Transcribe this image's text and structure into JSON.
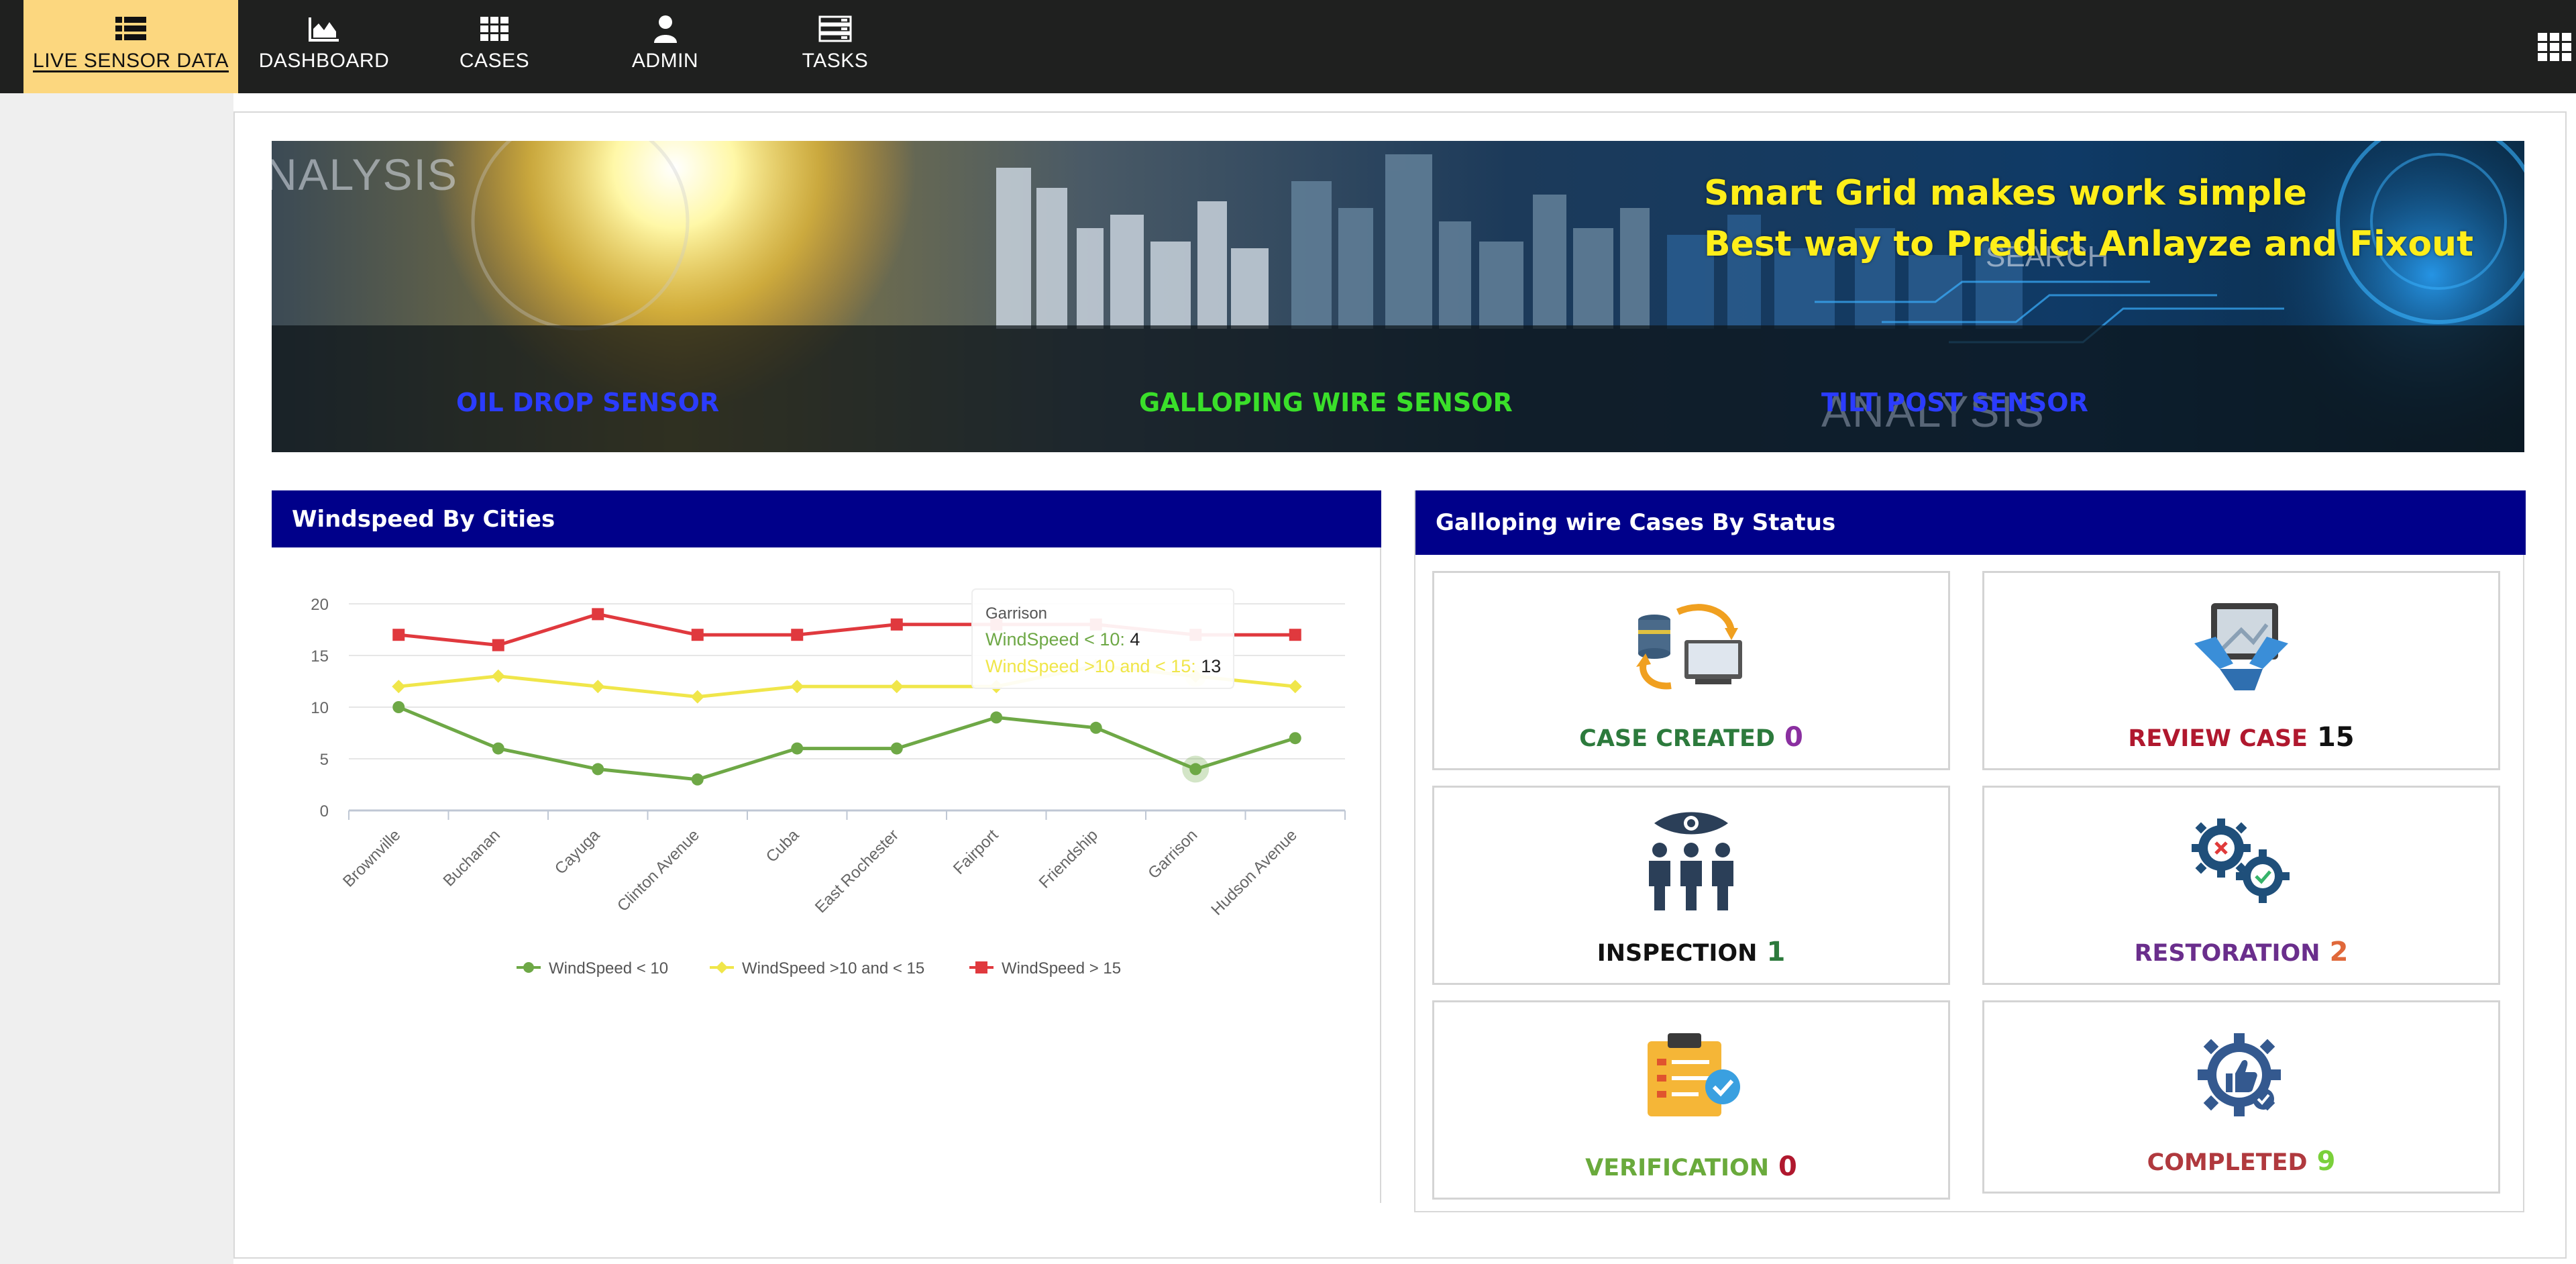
{
  "nav": {
    "items": [
      {
        "label": "LIVE SENSOR DATA",
        "icon": "list-icon",
        "active": true
      },
      {
        "label": "DASHBOARD",
        "icon": "area-chart-icon",
        "active": false
      },
      {
        "label": "CASES",
        "icon": "grid-icon",
        "active": false
      },
      {
        "label": "ADMIN",
        "icon": "user-icon",
        "active": false
      },
      {
        "label": "TASKS",
        "icon": "server-icon",
        "active": false
      }
    ],
    "apps_icon": "apps-grid-icon"
  },
  "banner": {
    "headline_line1": "Smart Grid makes work simple",
    "headline_line2": "Best way to Predict Anlayze and Fixout",
    "background_words": {
      "analysis_left": "NALYSIS",
      "search": "SEARCH",
      "analysis_right": "ANALYSIS"
    },
    "sensor_tabs": [
      {
        "label": "OIL DROP SENSOR",
        "color": "#2b3cff"
      },
      {
        "label": "GALLOPING WIRE SENSOR",
        "color": "#3adf2a"
      },
      {
        "label": "TILT POST SENSOR",
        "color": "#2b3cff"
      }
    ]
  },
  "windspeed": {
    "title": "Windspeed By Cities",
    "tooltip": {
      "city": "Garrison",
      "row1_label": "WindSpeed < 10: ",
      "row1_value": "4",
      "row2_label": "WindSpeed >10 and < 15: ",
      "row2_value": "13"
    }
  },
  "chart_data": {
    "type": "line",
    "categories": [
      "Brownville",
      "Buchanan",
      "Cayuga",
      "Clinton Avenue",
      "Cuba",
      "East Rochester",
      "Fairport",
      "Friendship",
      "Garrison",
      "Hudson Avenue"
    ],
    "series": [
      {
        "name": "WindSpeed < 10",
        "color": "#6ea846",
        "marker": "circle",
        "values": [
          10,
          6,
          4,
          3,
          6,
          6,
          9,
          8,
          4,
          7
        ]
      },
      {
        "name": "WindSpeed >10 and < 15",
        "color": "#f0e64a",
        "marker": "diamond",
        "values": [
          12,
          13,
          12,
          11,
          12,
          12,
          12,
          14,
          13,
          12
        ]
      },
      {
        "name": "WindSpeed > 15",
        "color": "#e0393e",
        "marker": "square",
        "values": [
          17,
          16,
          19,
          17,
          17,
          18,
          18,
          18,
          17,
          17
        ]
      }
    ],
    "yticks": [
      0,
      5,
      10,
      15,
      20
    ],
    "ylim": [
      0,
      20
    ],
    "grid": true,
    "legend": "bottom-center",
    "xlabel": "",
    "ylabel": "",
    "title": "Windspeed By Cities"
  },
  "status": {
    "title": "Galloping wire Cases By Status",
    "tiles": [
      {
        "label": "CASE CREATED",
        "count": "0",
        "label_color": "#2c7a3c",
        "count_color": "#8a2fa0",
        "icon": "database-sync-icon"
      },
      {
        "label": "REVIEW CASE",
        "count": "15",
        "label_color": "#b0182e",
        "count_color": "#111111",
        "icon": "tablet-review-icon"
      },
      {
        "label": "INSPECTION",
        "count": "1",
        "label_color": "#111111",
        "count_color": "#2c7a3c",
        "icon": "inspection-team-icon"
      },
      {
        "label": "RESTORATION",
        "count": "2",
        "label_color": "#6a2e8c",
        "count_color": "#e0683a",
        "icon": "gears-icon"
      },
      {
        "label": "VERIFICATION",
        "count": "0",
        "label_color": "#6aaa3c",
        "count_color": "#b0182e",
        "icon": "clipboard-check-icon"
      },
      {
        "label": "COMPLETED",
        "count": "9",
        "label_color": "#b0393e",
        "count_color": "#7ad03a",
        "icon": "gear-thumbs-up-icon"
      }
    ]
  }
}
